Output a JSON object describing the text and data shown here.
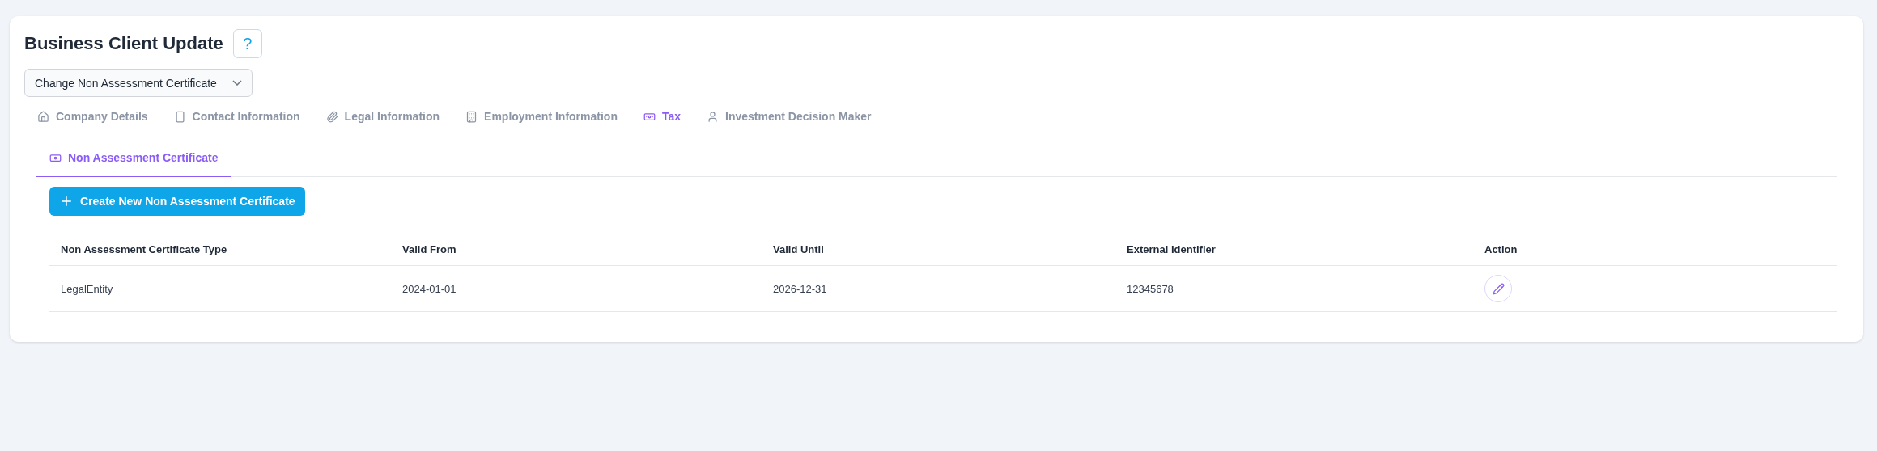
{
  "page": {
    "title": "Business Client Update",
    "help": "?"
  },
  "action_select": {
    "value": "Change Non Assessment Certificate"
  },
  "tabs": [
    {
      "label": "Company Details",
      "kind": "home",
      "selected": false
    },
    {
      "label": "Contact Information",
      "kind": "phone",
      "selected": false
    },
    {
      "label": "Legal Information",
      "kind": "clip",
      "selected": false
    },
    {
      "label": "Employment Information",
      "kind": "building",
      "selected": false
    },
    {
      "label": "Tax",
      "kind": "money",
      "selected": true
    },
    {
      "label": "Investment Decision Maker",
      "kind": "user",
      "selected": false
    }
  ],
  "subtabs": [
    {
      "label": "Non Assessment Certificate",
      "kind": "money",
      "selected": true
    }
  ],
  "create_button": {
    "label": "Create New Non Assessment Certificate"
  },
  "table": {
    "columns": [
      "Non Assessment Certificate Type",
      "Valid From",
      "Valid Until",
      "External Identifier",
      "Action"
    ],
    "rows": [
      {
        "cells": [
          "LegalEntity",
          "2024-01-01",
          "2026-12-31",
          "12345678"
        ]
      }
    ]
  }
}
